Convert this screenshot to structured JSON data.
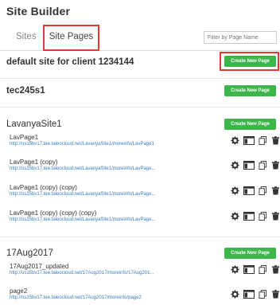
{
  "header": {
    "title": "Site Builder"
  },
  "tabs": {
    "sites": "Sites",
    "site_pages": "Site Pages"
  },
  "filter": {
    "placeholder": "Filter by Page Name"
  },
  "create_label": "Create New Page",
  "colors": {
    "create_button": "#3cb54a",
    "link": "#3a7bbf",
    "highlight": "#e53935"
  },
  "sites": [
    {
      "name": "default site for client 1234144",
      "pages": []
    },
    {
      "name": "tec245s1",
      "pages": []
    },
    {
      "name": "LavanyaSite1",
      "pages": [
        {
          "name": "LavPage1",
          "url": "http://os15bv17.tee.taleocloud.net/LavanyaSite1/moreinfo/LavPage1"
        },
        {
          "name": "LavPage1 (copy)",
          "url": "http://os15bv17.tee.taleocloud.net/LavanyaSite1/moreinfo/LavPage..."
        },
        {
          "name": "LavPage1 (copy) (copy)",
          "url": "http://os15bv17.tee.taleocloud.net/LavanyaSite1/moreinfo/LavPage..."
        },
        {
          "name": "LavPage1 (copy) (copy) (copy)",
          "url": "http://os15bv17.tee.taleocloud.net/LavanyaSite1/moreinfo/LavPage..."
        }
      ]
    },
    {
      "name": "17Aug2017",
      "pages": [
        {
          "name": "17Aug2017_updated",
          "url": "http://os15bv17.tee.taleocloud.net/17Aug2017/moreinfo/17Aug201..."
        },
        {
          "name": "page2",
          "url": "http://os15bv17.tee.taleocloud.net/17Aug2017/moreinfo/page2"
        }
      ]
    }
  ],
  "icons": [
    "gear-icon",
    "window-icon",
    "copy-icon",
    "trash-icon"
  ]
}
